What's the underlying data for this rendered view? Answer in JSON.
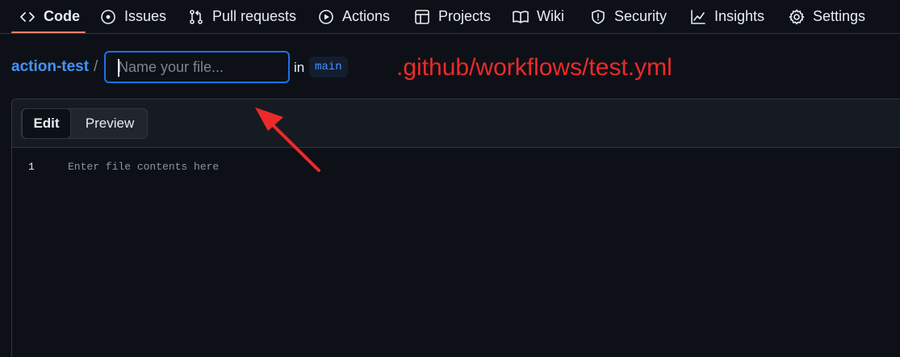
{
  "nav": {
    "items": [
      {
        "label": "Code",
        "icon": "code-icon",
        "selected": true
      },
      {
        "label": "Issues",
        "icon": "issue-opened-icon"
      },
      {
        "label": "Pull requests",
        "icon": "git-pull-request-icon"
      },
      {
        "label": "Actions",
        "icon": "play-icon"
      },
      {
        "label": "Projects",
        "icon": "table-icon"
      },
      {
        "label": "Wiki",
        "icon": "book-icon"
      },
      {
        "label": "Security",
        "icon": "shield-icon"
      },
      {
        "label": "Insights",
        "icon": "graph-icon"
      },
      {
        "label": "Settings",
        "icon": "gear-icon"
      }
    ]
  },
  "breadcrumb": {
    "repo": "action-test",
    "separator": "/",
    "filename_value": "",
    "filename_placeholder": "Name your file...",
    "in_label": "in",
    "branch": "main"
  },
  "annotation": {
    "text": ".github/workflows/test.yml",
    "color": "#ec2a2a"
  },
  "editor": {
    "tabs": {
      "edit": "Edit",
      "preview": "Preview"
    },
    "active_tab": "Edit",
    "line_number": "1",
    "placeholder": "Enter file contents here"
  },
  "colors": {
    "background": "#0d1117",
    "accent_link": "#4493f8",
    "focus_border": "#1f6feb",
    "selected_underline": "#f78166"
  }
}
